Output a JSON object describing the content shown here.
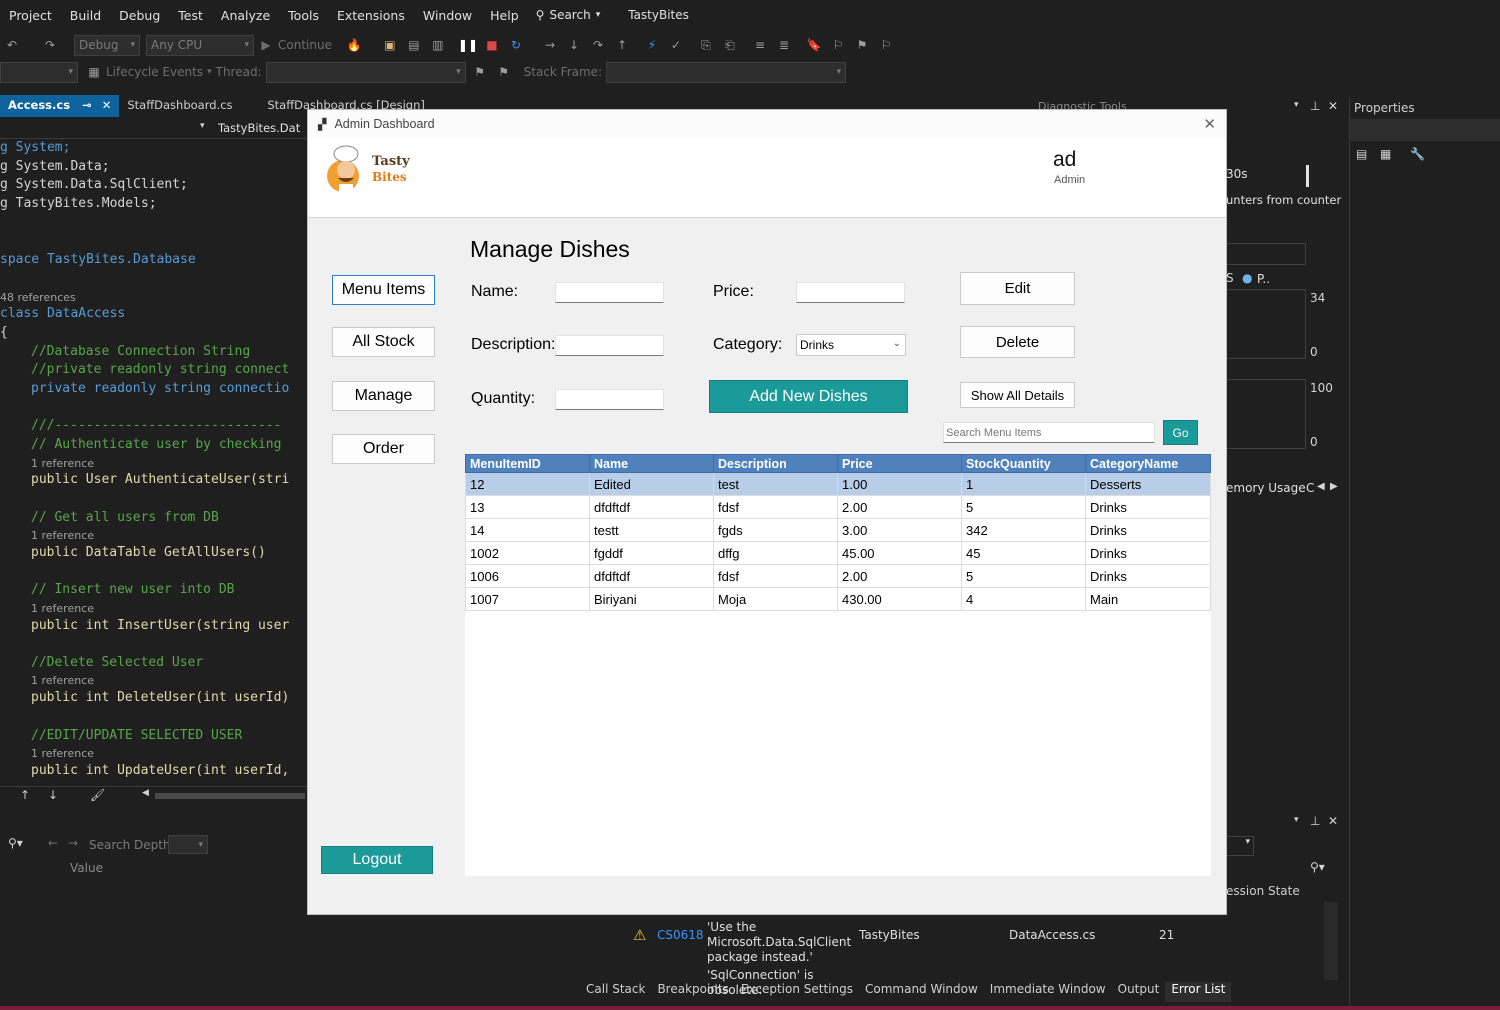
{
  "menubar": {
    "items": [
      "Project",
      "Build",
      "Debug",
      "Test",
      "Analyze",
      "Tools",
      "Extensions",
      "Window",
      "Help"
    ],
    "search_label": "Search",
    "app_name": "TastyBites"
  },
  "toolbar": {
    "config": "Debug",
    "platform": "Any CPU",
    "continue_label": "Continue",
    "lifecycle_label": "Lifecycle Events",
    "thread_label": "Thread:",
    "stack_frame_label": "Stack Frame:"
  },
  "editor": {
    "tabs": [
      "Access.cs",
      "StaffDashboard.cs",
      "StaffDashboard.cs [Design]"
    ],
    "nav_label": "TastyBites.Dat",
    "lines": {
      "u1": "g System;",
      "u2": "g System.Data;",
      "u3": "g System.Data.SqlClient;",
      "u4": "g TastyBites.Models;",
      "ns": "space TastyBites.Database",
      "refs48": "48 references",
      "cls": "class DataAccess",
      "brace": "{",
      "c1": "//Database Connection String",
      "c2": "//private readonly string connect",
      "c3": "private readonly string connectio",
      "c4": "///-----------------------------",
      "c5": "// Authenticate user by checking",
      "r1": "1 reference",
      "m1": "public User AuthenticateUser(stri",
      "c6": "// Get all users from DB",
      "r2": "1 reference",
      "m2": "public DataTable GetAllUsers()",
      "c7": "// Insert new user into DB",
      "r3": "1 reference",
      "m3": "public int InsertUser(string user",
      "c8": "//Delete Selected User",
      "r4": "1 reference",
      "m4": "public int DeleteUser(int userId)",
      "c9": "//EDIT/UPDATE SELECTED USER",
      "r5": "1 reference",
      "m5": "public int UpdateUser(int userId,"
    }
  },
  "locals": {
    "search_depth_label": "Search Depth:",
    "value_col": "Value"
  },
  "diagnostics": {
    "title": "Diagnostic Tools",
    "time": "30s",
    "counters": "unters from counter",
    "legend": "P..",
    "legend_prefix": "S",
    "y1_max": "34",
    "y1_min": "0",
    "y2_max": "100",
    "y2_min": "0",
    "tab": "emory Usage",
    "tab2": "C"
  },
  "properties": {
    "title": "Properties"
  },
  "session_state": "ession State",
  "error_list": {
    "code": "CS0618",
    "message_lines": [
      "'Use the",
      "Microsoft.Data.SqlClient",
      "package instead.'",
      "'SqlConnection' is obsolete:"
    ],
    "project": "TastyBites",
    "file": "DataAccess.cs",
    "line": "21"
  },
  "bottom_tabs": [
    "Call Stack",
    "Breakpoints",
    "Exception Settings",
    "Command Window",
    "Immediate Window",
    "Output",
    "Error List"
  ],
  "dialog": {
    "title": "Admin Dashboard",
    "logo_line1": "Tasty",
    "logo_line2": "Bites",
    "user_name": "ad",
    "user_role": "Admin",
    "sidebar": [
      "Menu Items",
      "All Stock",
      "Manage",
      "Order"
    ],
    "logout_label": "Logout",
    "heading": "Manage Dishes",
    "labels": {
      "name": "Name:",
      "price": "Price:",
      "description": "Description:",
      "category": "Category:",
      "quantity": "Quantity:"
    },
    "category_value": "Drinks",
    "buttons": {
      "edit": "Edit",
      "delete": "Delete",
      "add": "Add New Dishes",
      "show_all": "Show All Details",
      "go": "Go"
    },
    "search_placeholder": "Search Menu Items",
    "table": {
      "columns": [
        "MenuItemID",
        "Name",
        "Description",
        "Price",
        "StockQuantity",
        "CategoryName"
      ],
      "rows": [
        [
          "12",
          "Edited",
          "test",
          "1.00",
          "1",
          "Desserts"
        ],
        [
          "13",
          "dfdftdf",
          "fdsf",
          "2.00",
          "5",
          "Drinks"
        ],
        [
          "14",
          "testt",
          "fgds",
          "3.00",
          "342",
          "Drinks"
        ],
        [
          "1002",
          "fgddf",
          "dffg",
          "45.00",
          "45",
          "Drinks"
        ],
        [
          "1006",
          "dfdftdf",
          "fdsf",
          "2.00",
          "5",
          "Drinks"
        ],
        [
          "1007",
          "Biriyani",
          "Moja",
          "430.00",
          "4",
          "Main"
        ]
      ]
    }
  },
  "colors": {
    "accent_teal": "#1b9a9a",
    "grid_header": "#4f81bd",
    "selected_row": "#b7cde8"
  }
}
